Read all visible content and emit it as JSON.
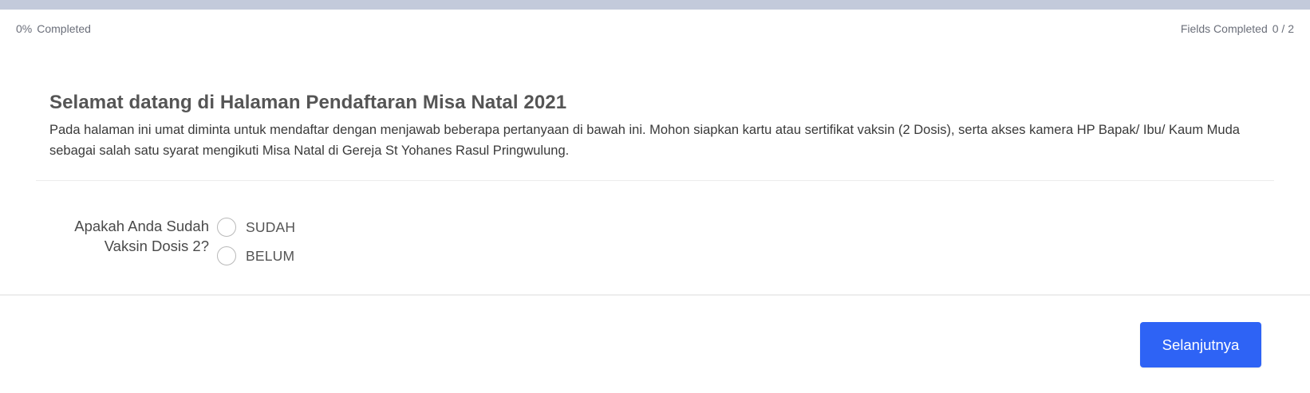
{
  "progress": {
    "percent_label": "0%",
    "completed_label": "Completed",
    "fields_label": "Fields Completed",
    "fields_count": "0 / 2",
    "fraction": 0
  },
  "header": {
    "title": "Selamat datang di Halaman Pendaftaran Misa Natal 2021",
    "description": "Pada halaman ini umat diminta untuk mendaftar dengan menjawab beberapa pertanyaan di bawah ini. Mohon siapkan kartu atau sertifikat vaksin (2 Dosis), serta akses kamera HP Bapak/ Ibu/ Kaum Muda sebagai salah satu syarat mengikuti Misa Natal di Gereja St Yohanes Rasul Pringwulung."
  },
  "question": {
    "label": "Apakah Anda Sudah Vaksin Dosis 2?",
    "options": [
      {
        "label": "SUDAH",
        "selected": false
      },
      {
        "label": "BELUM",
        "selected": false
      }
    ]
  },
  "footer": {
    "next_label": "Selanjutnya"
  },
  "colors": {
    "progress_track": "#c3cadb",
    "accent": "#2e63f5"
  }
}
